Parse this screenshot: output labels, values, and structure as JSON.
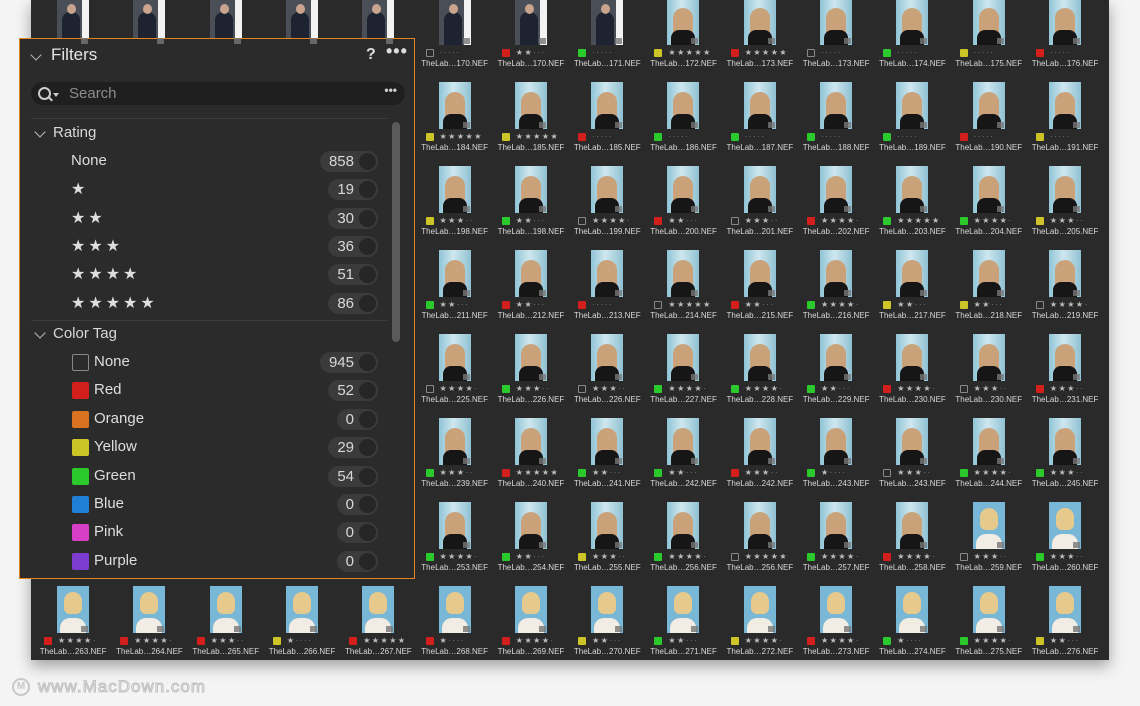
{
  "panel": {
    "title": "Filters",
    "help_label": "?",
    "more_label": "•••",
    "search": {
      "placeholder": "Search",
      "more_label": "•••"
    },
    "rating": {
      "header": "Rating",
      "items": [
        {
          "label": "None",
          "stars": 0,
          "count": "858"
        },
        {
          "label": "★",
          "stars": 1,
          "count": "19"
        },
        {
          "label": "★★",
          "stars": 2,
          "count": "30"
        },
        {
          "label": "★★★",
          "stars": 3,
          "count": "36"
        },
        {
          "label": "★★★★",
          "stars": 4,
          "count": "51"
        },
        {
          "label": "★★★★★",
          "stars": 5,
          "count": "86"
        }
      ]
    },
    "color_tag": {
      "header": "Color Tag",
      "items": [
        {
          "label": "None",
          "color": "none",
          "count": "945"
        },
        {
          "label": "Red",
          "color": "#d21f1b",
          "count": "52"
        },
        {
          "label": "Orange",
          "color": "#d9731f",
          "count": "0"
        },
        {
          "label": "Yellow",
          "color": "#cdc427",
          "count": "29"
        },
        {
          "label": "Green",
          "color": "#2cc92c",
          "count": "54"
        },
        {
          "label": "Blue",
          "color": "#1f7fd6",
          "count": "0"
        },
        {
          "label": "Pink",
          "color": "#d63fc6",
          "count": "0"
        },
        {
          "label": "Purple",
          "color": "#7c3cd0",
          "count": "0"
        }
      ]
    }
  },
  "colors": {
    "accent_border": "#e6841a",
    "red": "#d21f1b",
    "yellow": "#cdc427",
    "green": "#2cc92c"
  },
  "grid": {
    "rows": [
      [
        [
          "",
          "",
          "",
          0,
          "man"
        ],
        [
          "",
          "",
          "",
          0,
          "man"
        ],
        [
          "",
          "",
          "",
          0,
          "man"
        ],
        [
          "",
          "",
          "",
          0,
          "man"
        ],
        [
          "",
          "",
          "",
          0,
          "man"
        ],
        [
          "TheLab…170.NEF",
          "none",
          0,
          0,
          "man"
        ],
        [
          "TheLab…170.NEF",
          "red",
          2,
          0,
          "man"
        ],
        [
          "TheLab…171.NEF",
          "green",
          0,
          0,
          "man"
        ],
        [
          "TheLab…172.NEF",
          "yellow",
          5,
          0,
          "blonde"
        ],
        [
          "TheLab…173.NEF",
          "red",
          5,
          0,
          "blonde"
        ],
        [
          "TheLab…173.NEF",
          "none",
          0,
          0,
          "blonde"
        ],
        [
          "TheLab…174.NEF",
          "green",
          0,
          0,
          "blonde"
        ],
        [
          "TheLab…175.NEF",
          "yellow",
          0,
          0,
          "blonde"
        ],
        [
          "TheLab…176.NEF",
          "red",
          0,
          0,
          "blonde"
        ]
      ],
      [
        null,
        null,
        null,
        null,
        null,
        [
          "TheLab…184.NEF",
          "yellow",
          5,
          0,
          "blonde"
        ],
        [
          "TheLab…185.NEF",
          "yellow",
          5,
          0,
          "blonde"
        ],
        [
          "TheLab…185.NEF",
          "red",
          0,
          0,
          "blonde"
        ],
        [
          "TheLab…186.NEF",
          "green",
          0,
          0,
          "blonde"
        ],
        [
          "TheLab…187.NEF",
          "green",
          0,
          0,
          "blonde"
        ],
        [
          "TheLab…188.NEF",
          "green",
          0,
          0,
          "blonde"
        ],
        [
          "TheLab…189.NEF",
          "green",
          0,
          0,
          "blonde"
        ],
        [
          "TheLab…190.NEF",
          "red",
          0,
          0,
          "blonde"
        ],
        [
          "TheLab…191.NEF",
          "yellow",
          0,
          0,
          "blonde"
        ]
      ],
      [
        null,
        null,
        null,
        null,
        null,
        [
          "TheLab…198.NEF",
          "yellow",
          3,
          0,
          "blonde"
        ],
        [
          "TheLab…198.NEF",
          "green",
          2,
          0,
          "blonde"
        ],
        [
          "TheLab…199.NEF",
          "none",
          4,
          0,
          "blonde"
        ],
        [
          "TheLab…200.NEF",
          "red",
          2,
          0,
          "blonde"
        ],
        [
          "TheLab…201.NEF",
          "none",
          3,
          0,
          "blonde"
        ],
        [
          "TheLab…202.NEF",
          "red",
          4,
          0,
          "blonde"
        ],
        [
          "TheLab…203.NEF",
          "green",
          5,
          0,
          "blonde"
        ],
        [
          "TheLab…204.NEF",
          "green",
          4,
          0,
          "blonde"
        ],
        [
          "TheLab…205.NEF",
          "yellow",
          3,
          0,
          "blonde"
        ]
      ],
      [
        null,
        null,
        null,
        null,
        null,
        [
          "TheLab…211.NEF",
          "green",
          2,
          0,
          "blonde"
        ],
        [
          "TheLab…212.NEF",
          "red",
          2,
          0,
          "blonde"
        ],
        [
          "TheLab…213.NEF",
          "red",
          0,
          0,
          "blonde"
        ],
        [
          "TheLab…214.NEF",
          "none",
          5,
          0,
          "blonde"
        ],
        [
          "TheLab…215.NEF",
          "red",
          2,
          0,
          "blonde"
        ],
        [
          "TheLab…216.NEF",
          "green",
          4,
          0,
          "blonde"
        ],
        [
          "TheLab…217.NEF",
          "yellow",
          2,
          0,
          "blonde"
        ],
        [
          "TheLab…218.NEF",
          "yellow",
          2,
          0,
          "blonde"
        ],
        [
          "TheLab…219.NEF",
          "none",
          4,
          0,
          "blonde"
        ]
      ],
      [
        null,
        null,
        null,
        null,
        null,
        [
          "TheLab…225.NEF",
          "none",
          4,
          0,
          "blonde"
        ],
        [
          "TheLab…226.NEF",
          "green",
          3,
          0,
          "blonde"
        ],
        [
          "TheLab…226.NEF",
          "none",
          3,
          0,
          "blonde"
        ],
        [
          "TheLab…227.NEF",
          "green",
          4,
          0,
          "blonde"
        ],
        [
          "TheLab…228.NEF",
          "green",
          4,
          0,
          "blonde"
        ],
        [
          "TheLab…229.NEF",
          "green",
          2,
          0,
          "blonde"
        ],
        [
          "TheLab…230.NEF",
          "red",
          4,
          0,
          "blonde"
        ],
        [
          "TheLab…230.NEF",
          "none",
          3,
          0,
          "blonde"
        ],
        [
          "TheLab…231.NEF",
          "red",
          3,
          0,
          "blonde"
        ]
      ],
      [
        null,
        null,
        null,
        null,
        null,
        [
          "TheLab…239.NEF",
          "green",
          3,
          0,
          "blonde"
        ],
        [
          "TheLab…240.NEF",
          "red",
          5,
          0,
          "blonde"
        ],
        [
          "TheLab…241.NEF",
          "green",
          2,
          0,
          "blonde"
        ],
        [
          "TheLab…242.NEF",
          "green",
          2,
          0,
          "blonde"
        ],
        [
          "TheLab…242.NEF",
          "red",
          3,
          0,
          "blonde"
        ],
        [
          "TheLab…243.NEF",
          "green",
          1,
          0,
          "blonde"
        ],
        [
          "TheLab…243.NEF",
          "none",
          3,
          0,
          "blonde"
        ],
        [
          "TheLab…244.NEF",
          "green",
          4,
          0,
          "blonde"
        ],
        [
          "TheLab…245.NEF",
          "green",
          3,
          0,
          "blonde"
        ]
      ],
      [
        null,
        null,
        null,
        null,
        null,
        [
          "TheLab…253.NEF",
          "green",
          4,
          0,
          "blonde"
        ],
        [
          "TheLab…254.NEF",
          "green",
          2,
          0,
          "blonde"
        ],
        [
          "TheLab…255.NEF",
          "yellow",
          3,
          0,
          "blonde"
        ],
        [
          "TheLab…256.NEF",
          "green",
          4,
          0,
          "blonde"
        ],
        [
          "TheLab…256.NEF",
          "none",
          5,
          0,
          "blonde"
        ],
        [
          "TheLab…257.NEF",
          "green",
          4,
          0,
          "blonde"
        ],
        [
          "TheLab…258.NEF",
          "red",
          4,
          0,
          "blonde"
        ],
        [
          "TheLab…259.NEF",
          "none",
          3,
          0,
          "bob"
        ],
        [
          "TheLab…260.NEF",
          "green",
          3,
          0,
          "bob"
        ]
      ],
      [
        [
          "TheLab…263.NEF",
          "red",
          4,
          0,
          "bob"
        ],
        [
          "TheLab…264.NEF",
          "red",
          4,
          0,
          "bob"
        ],
        [
          "TheLab…265.NEF",
          "red",
          3,
          0,
          "bob"
        ],
        [
          "TheLab…266.NEF",
          "yellow",
          1,
          0,
          "bob"
        ],
        [
          "TheLab…267.NEF",
          "red",
          5,
          0,
          "bob"
        ],
        [
          "TheLab…268.NEF",
          "red",
          1,
          0,
          "bob"
        ],
        [
          "TheLab…269.NEF",
          "red",
          4,
          0,
          "bob"
        ],
        [
          "TheLab…270.NEF",
          "yellow",
          2,
          0,
          "bob"
        ],
        [
          "TheLab…271.NEF",
          "green",
          2,
          0,
          "bob"
        ],
        [
          "TheLab…272.NEF",
          "yellow",
          4,
          0,
          "bob"
        ],
        [
          "TheLab…273.NEF",
          "red",
          4,
          0,
          "bob"
        ],
        [
          "TheLab…274.NEF",
          "green",
          1,
          0,
          "bob"
        ],
        [
          "TheLab…275.NEF",
          "green",
          4,
          0,
          "bob"
        ],
        [
          "TheLab…276.NEF",
          "yellow",
          2,
          0,
          "bob"
        ]
      ]
    ]
  },
  "watermark": "www.MacDown.com"
}
